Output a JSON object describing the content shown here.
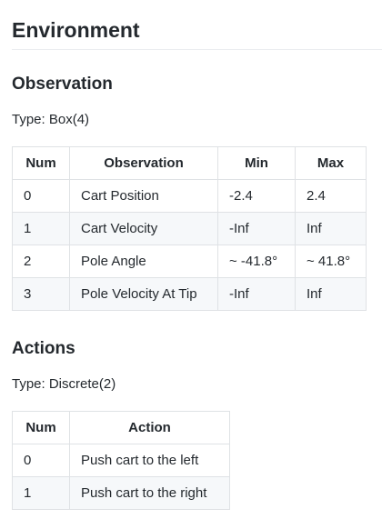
{
  "environment": {
    "title": "Environment"
  },
  "observation": {
    "heading": "Observation",
    "type_text": "Type: Box(4)",
    "columns": [
      "Num",
      "Observation",
      "Min",
      "Max"
    ],
    "rows": [
      [
        "0",
        "Cart Position",
        "-2.4",
        "2.4"
      ],
      [
        "1",
        "Cart Velocity",
        "-Inf",
        "Inf"
      ],
      [
        "2",
        "Pole Angle",
        "~ -41.8°",
        "~ 41.8°"
      ],
      [
        "3",
        "Pole Velocity At Tip",
        "-Inf",
        "Inf"
      ]
    ]
  },
  "actions": {
    "heading": "Actions",
    "type_text": "Type: Discrete(2)",
    "columns": [
      "Num",
      "Action"
    ],
    "rows": [
      [
        "0",
        "Push cart to the left"
      ],
      [
        "1",
        "Push cart to the right"
      ]
    ]
  }
}
